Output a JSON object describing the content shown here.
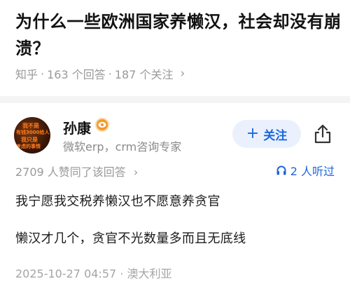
{
  "question": {
    "title": "为什么一些欧洲国家养懒汉，社会却没有崩溃？",
    "source": "知乎",
    "answers_count": "163 个回答",
    "followers": "187 个关注",
    "chevron": "›"
  },
  "author": {
    "name": "孙康",
    "description": "微软erp，crm咨询专家",
    "avatar_text": [
      "我不是",
      "有钱3000给人",
      "我只是",
      "考虑的事情"
    ]
  },
  "actions": {
    "follow_label": "关注",
    "follow_plus": "+",
    "share_icon": "share-icon"
  },
  "answer": {
    "votes": "2709 人赞同了该回答",
    "vote_chevron": "›",
    "listeners": "2 人听过",
    "lines": [
      "我宁愿我交税养懒汉也不愿意养贪官",
      "懒汉才几个，贪官不光数量多而且无底线"
    ],
    "timestamp": "2025-10-27 04:57 · 澳大利亚"
  },
  "colors": {
    "accent": "#1a66e0",
    "muted": "#999999",
    "follow_bg": "#eaf1fd"
  }
}
